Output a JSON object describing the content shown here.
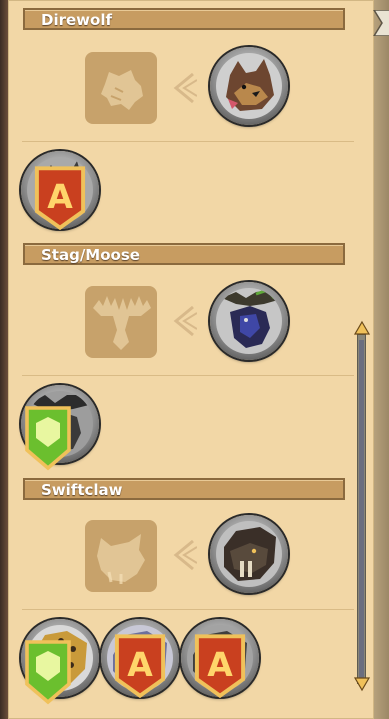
{
  "sections": [
    {
      "title": "Direwolf",
      "silhouette_icon": "wolf-silhouette-icon",
      "base_mount": "direwolf",
      "variants": [
        {
          "name": "armored-direwolf",
          "badge": "tier-a"
        }
      ]
    },
    {
      "title": "Stag/Moose",
      "silhouette_icon": "moose-silhouette-icon",
      "base_mount": "moose",
      "variants": [
        {
          "name": "armored-moose",
          "badge": "tier-green"
        }
      ]
    },
    {
      "title": "Swiftclaw",
      "silhouette_icon": "cat-silhouette-icon",
      "base_mount": "swiftclaw",
      "variants": [
        {
          "name": "leopard-swiftclaw",
          "badge": "tier-green"
        },
        {
          "name": "frost-swiftclaw",
          "badge": "tier-a"
        },
        {
          "name": "stone-swiftclaw",
          "badge": "tier-a"
        }
      ]
    }
  ],
  "badges": {
    "tier-a": {
      "glyph": "A",
      "color": "#c9401f"
    },
    "tier-green": {
      "glyph": "",
      "color": "#6bbf2e"
    }
  },
  "colors": {
    "panel": "#f2d7a6",
    "header": "#c79c61",
    "silhouette_tile": "#c7a26b",
    "silhouette_glyph": "#f6e1b8"
  }
}
